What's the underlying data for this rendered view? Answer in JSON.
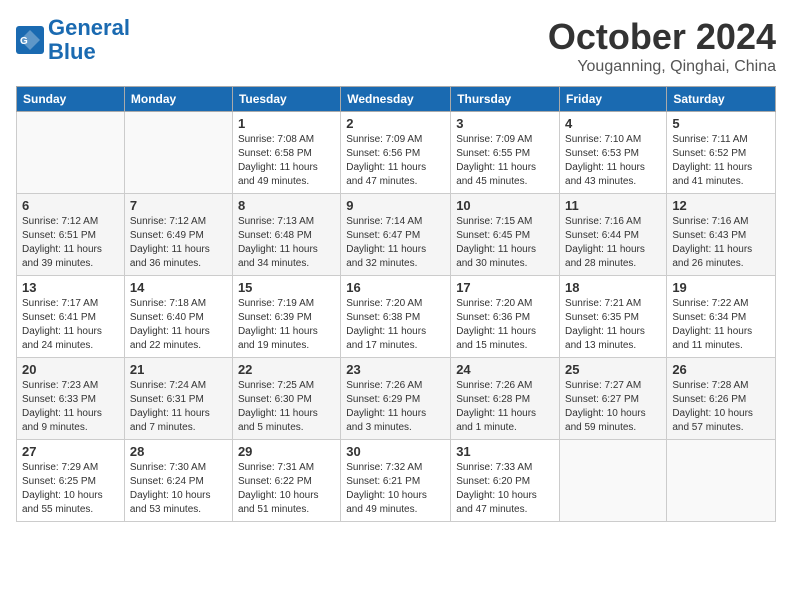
{
  "header": {
    "logo_line1": "General",
    "logo_line2": "Blue",
    "month": "October 2024",
    "location": "Youganning, Qinghai, China"
  },
  "days_of_week": [
    "Sunday",
    "Monday",
    "Tuesday",
    "Wednesday",
    "Thursday",
    "Friday",
    "Saturday"
  ],
  "weeks": [
    [
      {
        "day": "",
        "info": ""
      },
      {
        "day": "",
        "info": ""
      },
      {
        "day": "1",
        "info": "Sunrise: 7:08 AM\nSunset: 6:58 PM\nDaylight: 11 hours and 49 minutes."
      },
      {
        "day": "2",
        "info": "Sunrise: 7:09 AM\nSunset: 6:56 PM\nDaylight: 11 hours and 47 minutes."
      },
      {
        "day": "3",
        "info": "Sunrise: 7:09 AM\nSunset: 6:55 PM\nDaylight: 11 hours and 45 minutes."
      },
      {
        "day": "4",
        "info": "Sunrise: 7:10 AM\nSunset: 6:53 PM\nDaylight: 11 hours and 43 minutes."
      },
      {
        "day": "5",
        "info": "Sunrise: 7:11 AM\nSunset: 6:52 PM\nDaylight: 11 hours and 41 minutes."
      }
    ],
    [
      {
        "day": "6",
        "info": "Sunrise: 7:12 AM\nSunset: 6:51 PM\nDaylight: 11 hours and 39 minutes."
      },
      {
        "day": "7",
        "info": "Sunrise: 7:12 AM\nSunset: 6:49 PM\nDaylight: 11 hours and 36 minutes."
      },
      {
        "day": "8",
        "info": "Sunrise: 7:13 AM\nSunset: 6:48 PM\nDaylight: 11 hours and 34 minutes."
      },
      {
        "day": "9",
        "info": "Sunrise: 7:14 AM\nSunset: 6:47 PM\nDaylight: 11 hours and 32 minutes."
      },
      {
        "day": "10",
        "info": "Sunrise: 7:15 AM\nSunset: 6:45 PM\nDaylight: 11 hours and 30 minutes."
      },
      {
        "day": "11",
        "info": "Sunrise: 7:16 AM\nSunset: 6:44 PM\nDaylight: 11 hours and 28 minutes."
      },
      {
        "day": "12",
        "info": "Sunrise: 7:16 AM\nSunset: 6:43 PM\nDaylight: 11 hours and 26 minutes."
      }
    ],
    [
      {
        "day": "13",
        "info": "Sunrise: 7:17 AM\nSunset: 6:41 PM\nDaylight: 11 hours and 24 minutes."
      },
      {
        "day": "14",
        "info": "Sunrise: 7:18 AM\nSunset: 6:40 PM\nDaylight: 11 hours and 22 minutes."
      },
      {
        "day": "15",
        "info": "Sunrise: 7:19 AM\nSunset: 6:39 PM\nDaylight: 11 hours and 19 minutes."
      },
      {
        "day": "16",
        "info": "Sunrise: 7:20 AM\nSunset: 6:38 PM\nDaylight: 11 hours and 17 minutes."
      },
      {
        "day": "17",
        "info": "Sunrise: 7:20 AM\nSunset: 6:36 PM\nDaylight: 11 hours and 15 minutes."
      },
      {
        "day": "18",
        "info": "Sunrise: 7:21 AM\nSunset: 6:35 PM\nDaylight: 11 hours and 13 minutes."
      },
      {
        "day": "19",
        "info": "Sunrise: 7:22 AM\nSunset: 6:34 PM\nDaylight: 11 hours and 11 minutes."
      }
    ],
    [
      {
        "day": "20",
        "info": "Sunrise: 7:23 AM\nSunset: 6:33 PM\nDaylight: 11 hours and 9 minutes."
      },
      {
        "day": "21",
        "info": "Sunrise: 7:24 AM\nSunset: 6:31 PM\nDaylight: 11 hours and 7 minutes."
      },
      {
        "day": "22",
        "info": "Sunrise: 7:25 AM\nSunset: 6:30 PM\nDaylight: 11 hours and 5 minutes."
      },
      {
        "day": "23",
        "info": "Sunrise: 7:26 AM\nSunset: 6:29 PM\nDaylight: 11 hours and 3 minutes."
      },
      {
        "day": "24",
        "info": "Sunrise: 7:26 AM\nSunset: 6:28 PM\nDaylight: 11 hours and 1 minute."
      },
      {
        "day": "25",
        "info": "Sunrise: 7:27 AM\nSunset: 6:27 PM\nDaylight: 10 hours and 59 minutes."
      },
      {
        "day": "26",
        "info": "Sunrise: 7:28 AM\nSunset: 6:26 PM\nDaylight: 10 hours and 57 minutes."
      }
    ],
    [
      {
        "day": "27",
        "info": "Sunrise: 7:29 AM\nSunset: 6:25 PM\nDaylight: 10 hours and 55 minutes."
      },
      {
        "day": "28",
        "info": "Sunrise: 7:30 AM\nSunset: 6:24 PM\nDaylight: 10 hours and 53 minutes."
      },
      {
        "day": "29",
        "info": "Sunrise: 7:31 AM\nSunset: 6:22 PM\nDaylight: 10 hours and 51 minutes."
      },
      {
        "day": "30",
        "info": "Sunrise: 7:32 AM\nSunset: 6:21 PM\nDaylight: 10 hours and 49 minutes."
      },
      {
        "day": "31",
        "info": "Sunrise: 7:33 AM\nSunset: 6:20 PM\nDaylight: 10 hours and 47 minutes."
      },
      {
        "day": "",
        "info": ""
      },
      {
        "day": "",
        "info": ""
      }
    ]
  ]
}
